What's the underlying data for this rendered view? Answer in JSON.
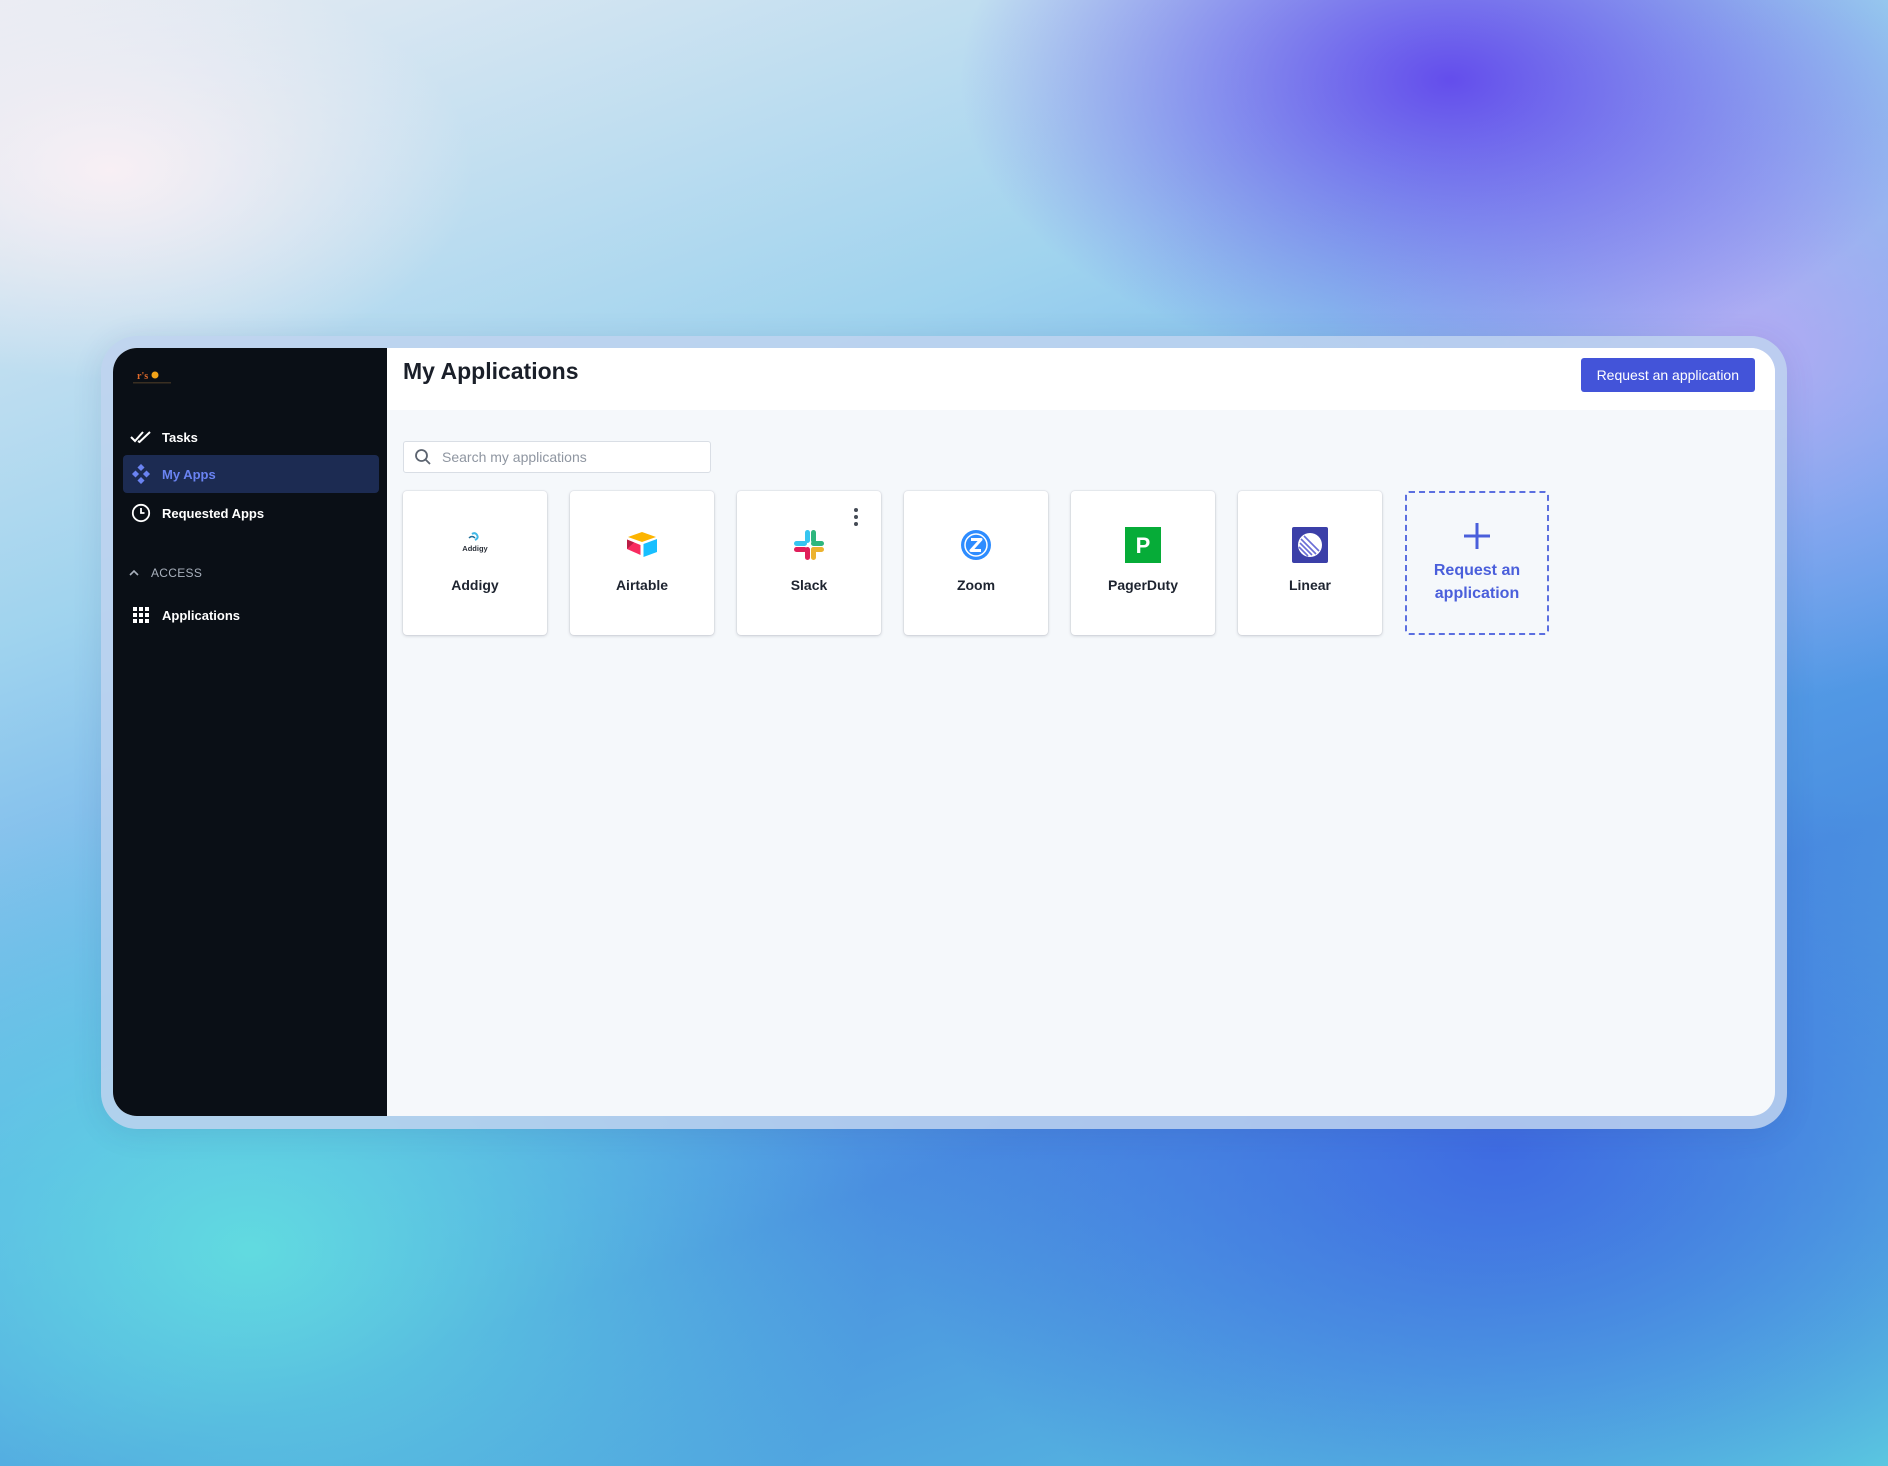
{
  "app": {
    "logo_text": "r's"
  },
  "sidebar": {
    "items": [
      {
        "label": "Tasks",
        "icon": "double-check-icon"
      },
      {
        "label": "My Apps",
        "icon": "apps-icon",
        "active": true
      },
      {
        "label": "Requested Apps",
        "icon": "clock-icon"
      }
    ],
    "section": {
      "label": "ACCESS",
      "icon": "chevron-up-icon"
    },
    "section_items": [
      {
        "label": "Applications",
        "icon": "grid-icon"
      }
    ]
  },
  "header": {
    "title": "My Applications",
    "request_button_label": "Request an application"
  },
  "search": {
    "placeholder": "Search my applications",
    "value": ""
  },
  "apps": [
    {
      "name": "Addigy",
      "icon": "addigy-logo-icon",
      "logo_text": "Addigy"
    },
    {
      "name": "Airtable",
      "icon": "airtable-logo-icon"
    },
    {
      "name": "Slack",
      "icon": "slack-logo-icon",
      "has_menu": true
    },
    {
      "name": "Zoom",
      "icon": "zoom-logo-icon"
    },
    {
      "name": "PagerDuty",
      "icon": "pagerduty-logo-icon",
      "logo_text": "P"
    },
    {
      "name": "Linear",
      "icon": "linear-logo-icon"
    }
  ],
  "request_card": {
    "label": "Request an application",
    "icon": "plus-icon"
  },
  "colors": {
    "accent": "#4354d9",
    "sidebar_bg": "#0a0f16",
    "sidebar_active_bg": "#1c2b52",
    "sidebar_active_text": "#6a83f2",
    "content_bg": "#f5f8fb",
    "zoom": "#2d8cff",
    "pagerduty": "#06ac38",
    "linear": "#4b4fc4"
  }
}
